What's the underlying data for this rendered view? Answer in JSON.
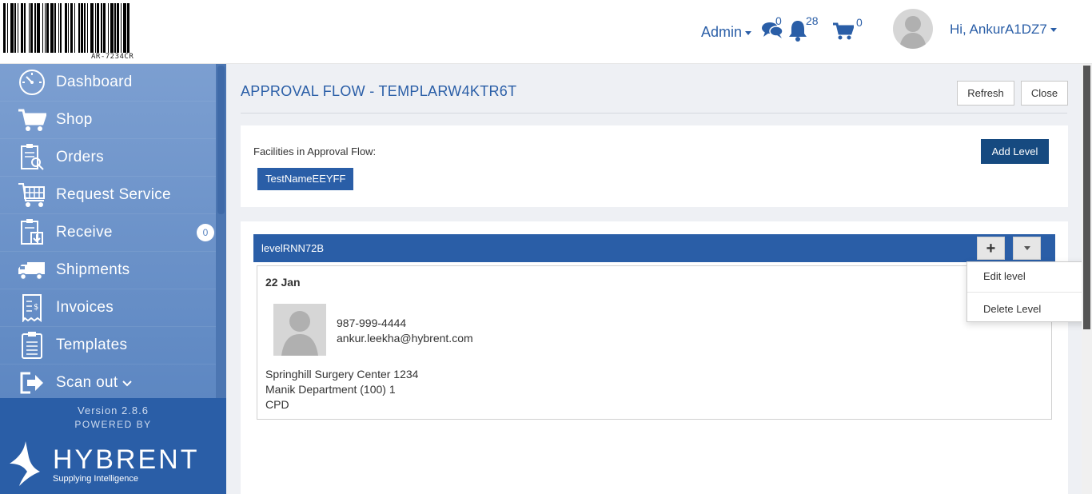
{
  "header": {
    "logo_code": "AR-7234CR",
    "admin_label": "Admin",
    "messages_count": "0",
    "notifications_count": "28",
    "cart_count": "0",
    "user_greeting": "Hi, AnkurA1DZ7",
    "icons": [
      "chat-icon",
      "bell-icon",
      "cart-icon"
    ]
  },
  "sidebar": {
    "items": [
      {
        "label": "Dashboard",
        "icon": "dashboard-icon"
      },
      {
        "label": "Shop",
        "icon": "cart-icon"
      },
      {
        "label": "Orders",
        "icon": "clipboard-search-icon"
      },
      {
        "label": "Request Service",
        "icon": "service-cart-icon"
      },
      {
        "label": "Receive",
        "icon": "receive-icon",
        "badge": "0"
      },
      {
        "label": "Shipments",
        "icon": "truck-icon"
      },
      {
        "label": "Invoices",
        "icon": "invoice-icon"
      },
      {
        "label": "Templates",
        "icon": "templates-icon"
      },
      {
        "label": "Scan out",
        "icon": "scan-out-icon"
      }
    ],
    "version": "Version 2.8.6",
    "powered_by": "POWERED BY",
    "brand_name": "HYBRENT",
    "brand_tagline": "Supplying Intelligence"
  },
  "main": {
    "title": "APPROVAL FLOW - TEMPLARW4KTR6T",
    "refresh_label": "Refresh",
    "close_label": "Close",
    "facilities_label": "Facilities in Approval Flow:",
    "facility_chip": "TestNameEEYFF",
    "add_level_label": "Add Level",
    "level": {
      "name": "levelRNN72B",
      "add_symbol": "+",
      "card": {
        "date": "22 Jan",
        "phone": "987-999-4444",
        "email": "ankur.leekha@hybrent.com",
        "facility": "Springhill Surgery Center 1234",
        "department": "Manik Department (100) 1",
        "code": "CPD"
      }
    },
    "dropdown": {
      "items": [
        "Edit level",
        "Delete Level"
      ]
    }
  },
  "colors": {
    "primary": "#2a5ea7",
    "dark_primary": "#164a80",
    "sidebar": "#6e94c8"
  }
}
